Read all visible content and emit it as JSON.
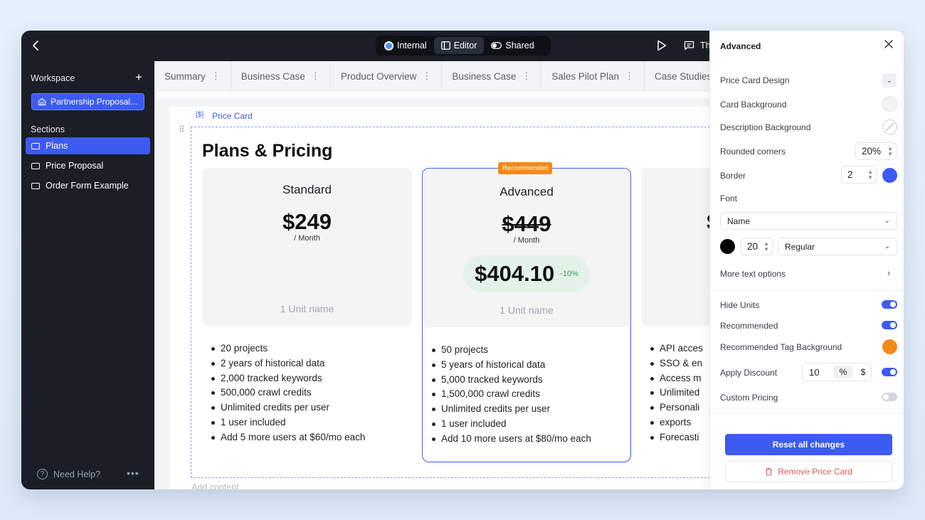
{
  "topbar": {
    "modes": [
      {
        "label": "Internal",
        "icon": "globe-dot-icon",
        "active": false
      },
      {
        "label": "Editor",
        "icon": "panel-icon",
        "active": true
      },
      {
        "label": "Shared",
        "icon": "toggle-icon",
        "active": false
      }
    ],
    "cut_label": "Th"
  },
  "sidebar": {
    "workspace_title": "Workspace",
    "workspace_item": "Partnership Proposal...",
    "sections_title": "Sections",
    "items": [
      {
        "label": "Plans",
        "active": true
      },
      {
        "label": "Price Proposal",
        "active": false
      },
      {
        "label": "Order Form Example",
        "active": false
      }
    ],
    "help_label": "Need Help?"
  },
  "tabs": [
    "Summary",
    "Business Case",
    "Product Overview",
    "Business Case",
    "Sales Pilot Plan",
    "Case Studies"
  ],
  "canvas": {
    "block_icon": "[$]",
    "block_label": "Price Card",
    "page_title": "Plans & Pricing",
    "add_content": "Add content",
    "cards": {
      "standard": {
        "name": "Standard",
        "price": "$249",
        "period": "/ Month",
        "unit": "1 Unit name",
        "features": [
          "20 projects",
          "2 years of historical data",
          "2,000 tracked keywords",
          "500,000 crawl credits",
          "Unlimited credits per user",
          "1 user included",
          "Add 5 more users at $60/mo each"
        ]
      },
      "advanced": {
        "tag": "Recommended",
        "name": "Advanced",
        "price": "$449",
        "period": "/ Month",
        "discount_price": "$404.10",
        "discount_pct": "-10%",
        "unit": "1 Unit name",
        "features": [
          "50 projects",
          "5 years of historical data",
          "5,000 tracked keywords",
          "1,500,000 crawl credits",
          "Unlimited credits per user",
          "1 user included",
          "Add 10 more users at $80/mo each"
        ]
      },
      "third": {
        "price_fragment": "$",
        "features": [
          "API acces",
          "SSO & en",
          "Access m",
          "Unlimited",
          "Personali",
          "exports",
          "Forecasti"
        ]
      }
    }
  },
  "panel": {
    "title": "Advanced",
    "design_label": "Price Card Design",
    "card_bg_label": "Card Background",
    "desc_bg_label": "Description Background",
    "rounded_label": "Rounded corners",
    "rounded_value": "20%",
    "border_label": "Border",
    "border_value": "2",
    "border_color": "#3d5af1",
    "font_label": "Font",
    "font_target": "Name",
    "font_color": "#000000",
    "font_size": "20",
    "font_weight": "Regular",
    "more_text": "More text options",
    "hide_units_label": "Hide Units",
    "hide_units_on": true,
    "recommended_label": "Recommended",
    "recommended_on": true,
    "rec_tag_bg_label": "Recommended Tag Background",
    "rec_tag_color": "#f28a18",
    "apply_discount_label": "Apply Discount",
    "discount_value": "10",
    "discount_unit_pct": "%",
    "discount_unit_usd": "$",
    "apply_discount_on": true,
    "custom_pricing_label": "Custom Pricing",
    "custom_pricing_on": false,
    "reset_label": "Reset all changes",
    "remove_label": "Remove Price Card"
  }
}
